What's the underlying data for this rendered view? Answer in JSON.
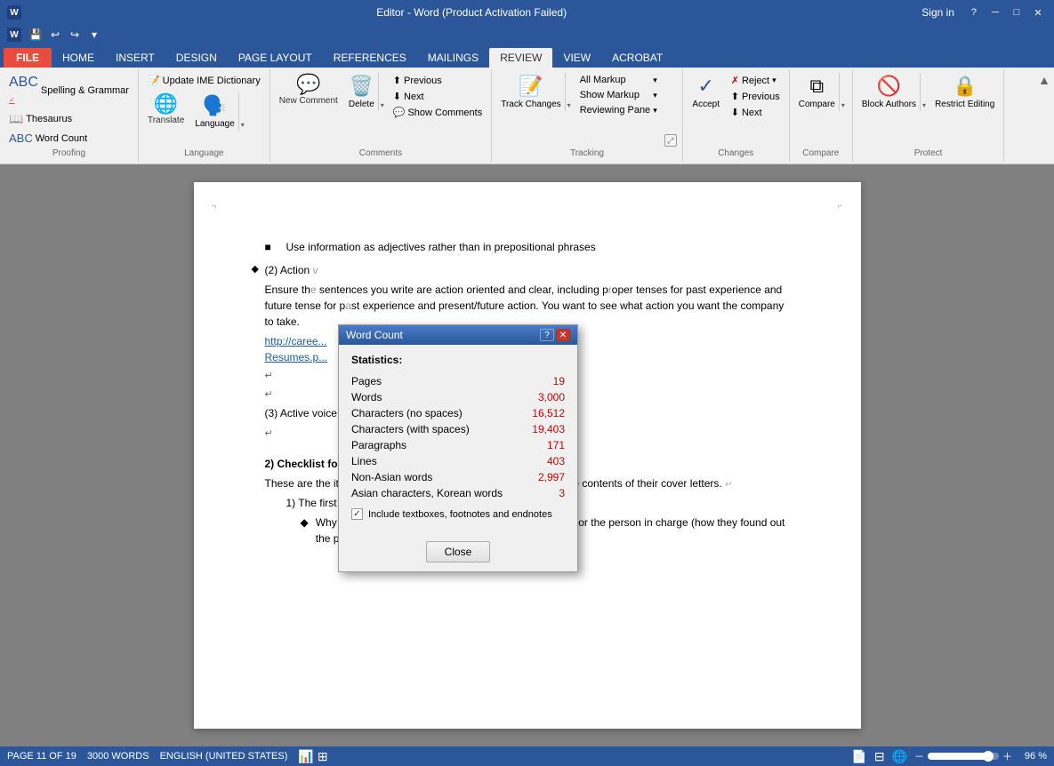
{
  "titleBar": {
    "title": "Editor - Word (Product Activation Failed)",
    "helpBtn": "?",
    "minimizeBtn": "─",
    "restoreBtn": "□",
    "closeBtn": "✕",
    "signIn": "Sign in"
  },
  "quickAccess": {
    "buttons": [
      "💾",
      "↩",
      "↪",
      "▾"
    ]
  },
  "tabs": [
    {
      "id": "file",
      "label": "FILE",
      "active": false,
      "isFile": true
    },
    {
      "id": "home",
      "label": "HOME",
      "active": false
    },
    {
      "id": "insert",
      "label": "INSERT",
      "active": false
    },
    {
      "id": "design",
      "label": "DESIGN",
      "active": false
    },
    {
      "id": "pagelayout",
      "label": "PAGE LAYOUT",
      "active": false
    },
    {
      "id": "references",
      "label": "REFERENCES",
      "active": false
    },
    {
      "id": "mailings",
      "label": "MAILINGS",
      "active": false
    },
    {
      "id": "review",
      "label": "REVIEW",
      "active": true
    },
    {
      "id": "view",
      "label": "VIEW",
      "active": false
    },
    {
      "id": "acrobat",
      "label": "ACROBAT",
      "active": false
    }
  ],
  "ribbon": {
    "proofing": {
      "label": "Proofing",
      "spellingLabel": "Spelling &\nGrammar",
      "thesaurusLabel": "Thesaurus",
      "wordCountLabel": "Word Count"
    },
    "language": {
      "label": "Language",
      "translateLabel": "Translate",
      "languageLabel": "Language",
      "updateIMELabel": "Update IME Dictionary"
    },
    "comments": {
      "label": "Comments",
      "newCommentLabel": "New\nComment",
      "deleteLabel": "Delete",
      "previousLabel": "Previous",
      "nextLabel": "Next",
      "showCommentsLabel": "Show Comments"
    },
    "tracking": {
      "label": "Tracking",
      "trackChangesLabel": "Track\nChanges",
      "allMarkupLabel": "All Markup",
      "showMarkupLabel": "Show Markup",
      "reviewingPaneLabel": "Reviewing Pane",
      "expandLabel": "⤢"
    },
    "changes": {
      "label": "Changes",
      "acceptLabel": "Accept",
      "rejectLabel": "Reject",
      "previousLabel": "Previous",
      "nextLabel": "Next"
    },
    "compare": {
      "label": "Compare",
      "compareLabel": "Compare"
    },
    "protect": {
      "label": "Protect",
      "blockAuthorsLabel": "Block\nAuthors",
      "restrictEditingLabel": "Restrict\nEditing"
    }
  },
  "wordCount": {
    "title": "Word Count",
    "statisticsLabel": "Statistics:",
    "rows": [
      {
        "label": "Pages",
        "value": "19"
      },
      {
        "label": "Words",
        "value": "3,000"
      },
      {
        "label": "Characters (no spaces)",
        "value": "16,512"
      },
      {
        "label": "Characters (with spaces)",
        "value": "19,403"
      },
      {
        "label": "Paragraphs",
        "value": "171"
      },
      {
        "label": "Lines",
        "value": "403"
      },
      {
        "label": "Non-Asian words",
        "value": "2,997"
      },
      {
        "label": "Asian characters, Korean words",
        "value": "3"
      }
    ],
    "checkboxLabel": "Include textboxes, footnotes and endnotes",
    "closeBtn": "Close"
  },
  "document": {
    "content": [
      "Use information as adjectives rather than in prepositional",
      "phrases",
      "(2) Action verbs and active sentences",
      "Ensure the sentences you write are action oriented and clear, including proper tenses for past experience and future actions. Use tense for past experience and present/future action. You want to see what action you want the company to take.",
      "http://career...",
      "Resumes.p...",
      "(3) Active voice rather than passive voice",
      "2) Checklist for Cover Letter",
      "These are the items that you can give our customers regarding the contents of their cover letters.",
      "1) The first paragraph:",
      "Why they are contacting the corresponding department or the person in charge (how they found out the position for which"
    ]
  },
  "statusBar": {
    "page": "PAGE 11 OF 19",
    "words": "3000 WORDS",
    "language": "ENGLISH (UNITED STATES)",
    "zoomLevel": "96 %",
    "zoomPercent": 96
  }
}
